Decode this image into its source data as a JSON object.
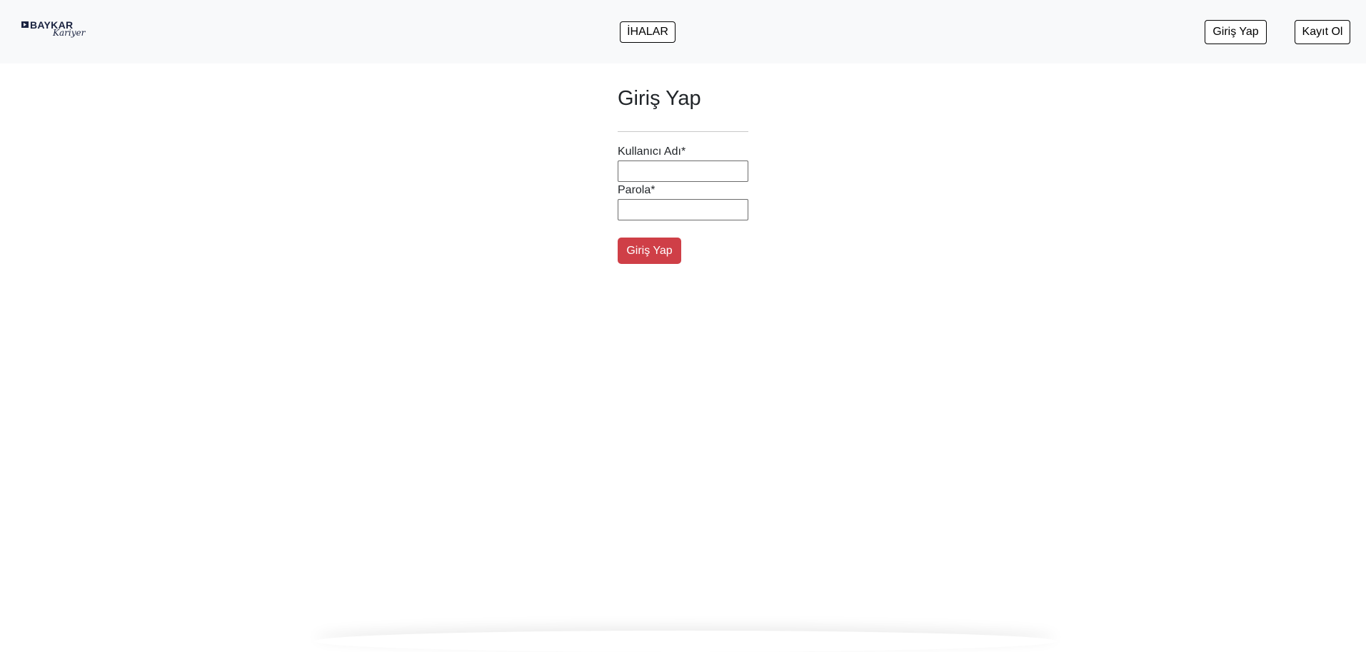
{
  "navbar": {
    "logo": {
      "wordmark": "BAYKAR",
      "script": "Kariyer",
      "brand_color": "#1a2340"
    },
    "ihalar_label": "İHALAR",
    "login_label": "Giriş Yap",
    "register_label": "Kayıt Ol",
    "background": "#f8f9fa"
  },
  "main": {
    "title": "Giriş Yap",
    "username_label": "Kullanıcı Adı*",
    "username_value": "",
    "password_label": "Parola*",
    "password_value": "",
    "submit_label": "Giriş Yap",
    "submit_color": "#cf3f47"
  }
}
